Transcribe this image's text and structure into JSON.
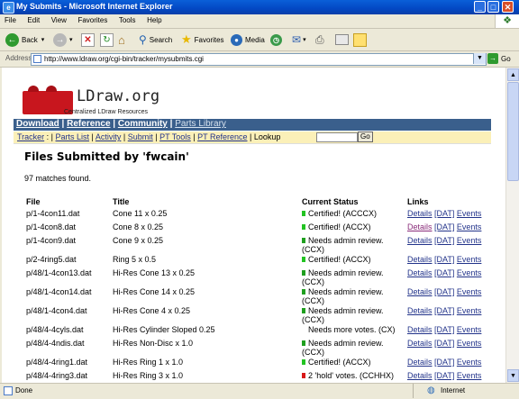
{
  "window": {
    "title": "My Submits - Microsoft Internet Explorer"
  },
  "menu": [
    "File",
    "Edit",
    "View",
    "Favorites",
    "Tools",
    "Help"
  ],
  "toolbar": {
    "back": "Back",
    "search": "Search",
    "favorites": "Favorites",
    "media": "Media"
  },
  "address": {
    "label": "Address",
    "url": "http://www.ldraw.org/cgi-bin/tracker/mysubmits.cgi",
    "go": "Go"
  },
  "site": {
    "logo": "LDraw.org",
    "tagline": "Centralized LDraw Resources",
    "nav": [
      "Download",
      "Reference",
      "Community",
      "Parts Library"
    ],
    "subnav": [
      "Tracker",
      "Parts List",
      "Activity",
      "Submit",
      "PT Tools",
      "PT Reference"
    ],
    "lookup": "Lookup",
    "lookup_go": "Go"
  },
  "page": {
    "title": "Files Submitted by 'fwcain'",
    "matches": "97 matches found.",
    "headers": {
      "file": "File",
      "title": "Title",
      "status": "Current Status",
      "links": "Links"
    },
    "link_labels": {
      "details": "Details",
      "dat": "[DAT]",
      "events": "Events"
    },
    "rows": [
      {
        "file": "p/1-4con11.dat",
        "title": "Cone 11 x 0.25",
        "status": "Certified! (ACCCX)",
        "color": "#22c322"
      },
      {
        "file": "p/1-4con8.dat",
        "title": "Cone 8 x 0.25",
        "status": "Certified! (ACCX)",
        "color": "#22c322"
      },
      {
        "file": "p/1-4con9.dat",
        "title": "Cone 9 x 0.25",
        "status": "Needs admin review. (CCX)",
        "color": "#1f9f1f"
      },
      {
        "file": "p/2-4ring5.dat",
        "title": "Ring 5 x 0.5",
        "status": "Certified! (ACCX)",
        "color": "#22c322"
      },
      {
        "file": "p/48/1-4con13.dat",
        "title": "Hi-Res Cone 13 x 0.25",
        "status": "Needs admin review. (CCX)",
        "color": "#1f9f1f"
      },
      {
        "file": "p/48/1-4con14.dat",
        "title": "Hi-Res Cone 14 x 0.25",
        "status": "Needs admin review. (CCX)",
        "color": "#1f9f1f"
      },
      {
        "file": "p/48/1-4con4.dat",
        "title": "Hi-Res Cone 4 x 0.25",
        "status": "Needs admin review. (CCX)",
        "color": "#1f9f1f"
      },
      {
        "file": "p/48/4-4cyls.dat",
        "title": "Hi-Res Cylinder Sloped 0.25",
        "status": "Needs more votes. (CX)",
        "color": ""
      },
      {
        "file": "p/48/4-4ndis.dat",
        "title": "Hi-Res Non-Disc x 1.0",
        "status": "Needs admin review. (CCX)",
        "color": "#1f9f1f"
      },
      {
        "file": "p/48/4-4ring1.dat",
        "title": "Hi-Res Ring 1 x 1.0",
        "status": "Certified! (ACCX)",
        "color": "#22c322"
      },
      {
        "file": "p/48/4-4ring3.dat",
        "title": "Hi-Res Ring 3 x 1.0",
        "status": "2 'hold' votes. (CCHHX)",
        "color": "#d81818"
      }
    ]
  },
  "status": {
    "left": "Done",
    "right": "Internet"
  }
}
